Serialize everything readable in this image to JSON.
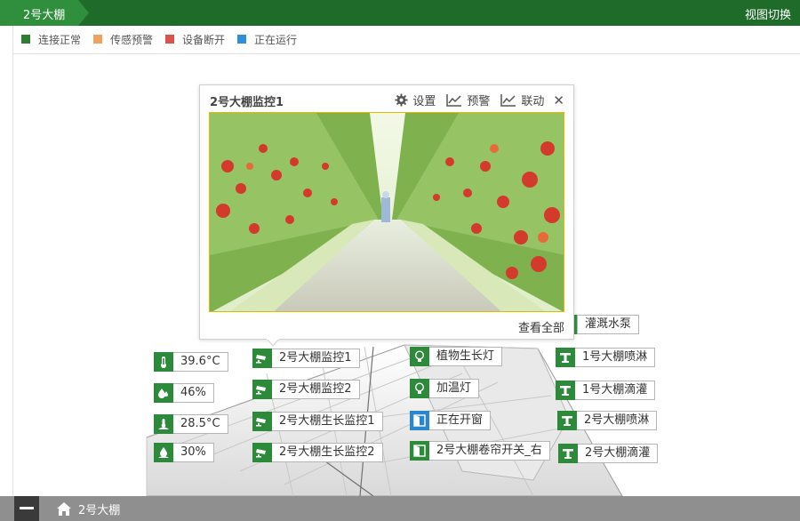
{
  "header": {
    "breadcrumb": "2号大棚",
    "view_switch": "视图切换"
  },
  "legend": [
    {
      "label": "连接正常",
      "color": "#2e7d32"
    },
    {
      "label": "传感预警",
      "color": "#f0a35e"
    },
    {
      "label": "设备断开",
      "color": "#d9534f"
    },
    {
      "label": "正在运行",
      "color": "#2f8fd8"
    }
  ],
  "popup": {
    "title": "2号大棚监控1",
    "settings": "设置",
    "warning": "预警",
    "linkage": "联动",
    "view_all": "查看全部"
  },
  "sensors": [
    {
      "value": "39.6°C",
      "icon": "thermometer-icon"
    },
    {
      "value": "46%",
      "icon": "humidity-drop-icon"
    },
    {
      "value": "28.5°C",
      "icon": "soil-temperature-icon"
    },
    {
      "value": "30%",
      "icon": "soil-moisture-icon"
    }
  ],
  "cameras": [
    "2号大棚监控1",
    "2号大棚监控2",
    "2号大棚生长监控1",
    "2号大棚生长监控2"
  ],
  "lights": [
    "植物生长灯",
    "加温灯"
  ],
  "window": {
    "open": "正在开窗",
    "curtain": "2号大棚卷帘开关_右"
  },
  "irrigation": {
    "pump": "灌溉水泵",
    "items": [
      "1号大棚喷淋",
      "1号大棚滴灌",
      "2号大棚喷淋",
      "2号大棚滴灌"
    ]
  },
  "footer": {
    "location": "2号大棚"
  }
}
